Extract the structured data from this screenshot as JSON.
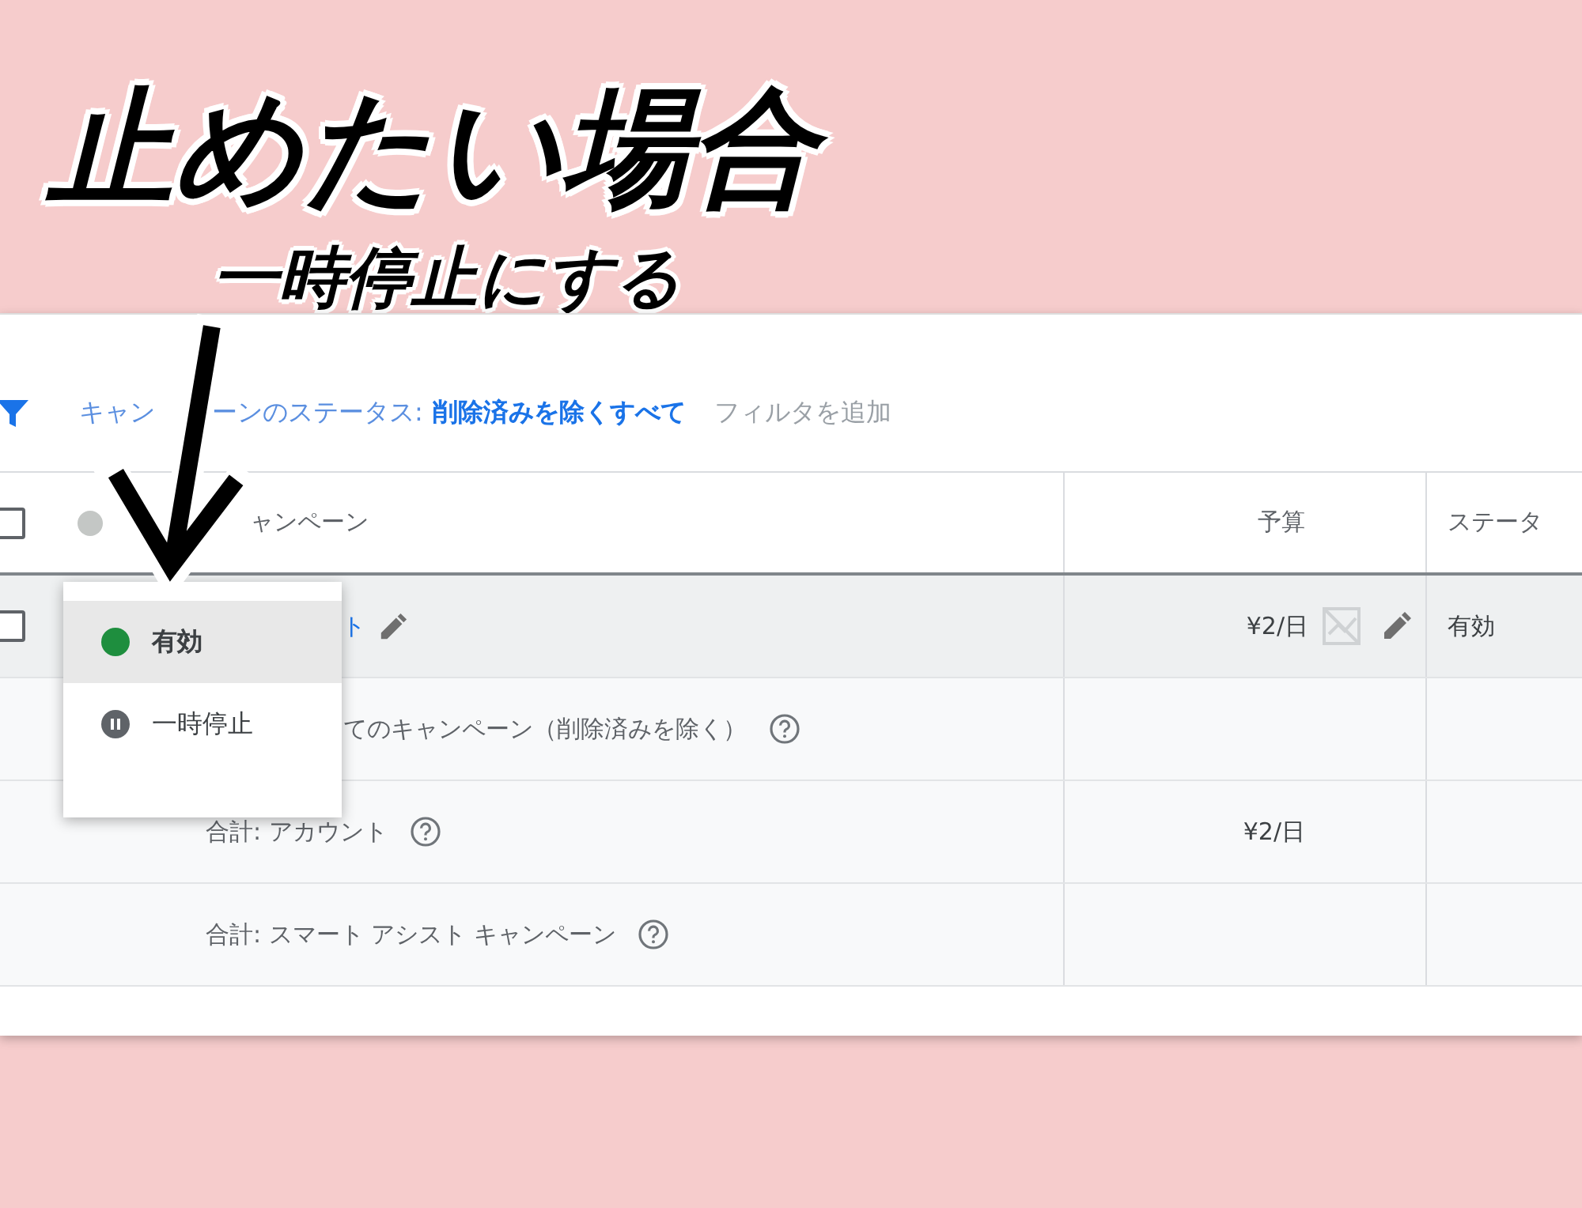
{
  "annotation": {
    "title": "止めたい場合",
    "subtitle": "一時停止にする"
  },
  "filter_bar": {
    "label_parts": [
      "キャン",
      "ーンのステータス:"
    ],
    "value": "削除済みを除くすべて",
    "add_filter": "フィルタを追加"
  },
  "table": {
    "header": {
      "checked": false,
      "columns": [
        "ャンペーン",
        "予算",
        "ステータ"
      ]
    },
    "rows": [
      {
        "kind": "campaign",
        "checked": false,
        "name": "ト",
        "budget": "¥2/日",
        "status": "有効"
      },
      {
        "kind": "all",
        "name": "てのキャンペーン（削除済みを除く）"
      },
      {
        "kind": "total",
        "name": "合計: アカウント",
        "budget": "¥2/日"
      },
      {
        "kind": "total",
        "name": "合計: スマート アシスト キャンペーン"
      }
    ]
  },
  "status_menu": {
    "items": [
      {
        "kind": "enabled",
        "label": "有効",
        "selected": true
      },
      {
        "kind": "paused",
        "label": "一時停止",
        "selected": false
      }
    ]
  }
}
